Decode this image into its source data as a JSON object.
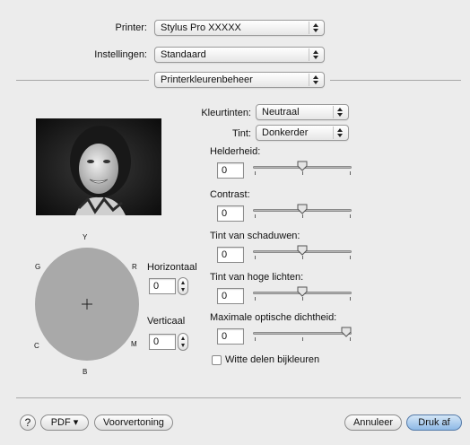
{
  "header": {
    "printer_label": "Printer:",
    "printer_value": "Stylus Pro XXXXX",
    "settings_label": "Instellingen:",
    "settings_value": "Standaard",
    "section_value": "Printerkleurenbeheer"
  },
  "color_tones": {
    "label": "Kleurtinten:",
    "value": "Neutraal"
  },
  "tone": {
    "label": "Tint:",
    "value": "Donkerder"
  },
  "sliders": [
    {
      "label": "Helderheid:",
      "value": "0",
      "level": 0.5
    },
    {
      "label": "Contrast:",
      "value": "0",
      "level": 0.5
    },
    {
      "label": "Tint van schaduwen:",
      "value": "0",
      "level": 0.5
    },
    {
      "label": "Tint van hoge lichten:",
      "value": "0",
      "level": 0.5
    },
    {
      "label": "Maximale optische dichtheid:",
      "value": "0",
      "level": 1.0
    }
  ],
  "color_circle": {
    "labels": {
      "y": "Y",
      "r": "R",
      "m": "M",
      "b": "B",
      "c": "C",
      "g": "G"
    },
    "horizontal_label": "Horizontaal",
    "horizontal_value": "0",
    "vertical_label": "Verticaal",
    "vertical_value": "0",
    "fill_color": "#a9a9a9"
  },
  "checkbox": {
    "label": "Witte delen bijkleuren",
    "checked": false
  },
  "footer": {
    "help_label": "?",
    "pdf_label": "PDF ▾",
    "preview_label": "Voorvertoning",
    "cancel_label": "Annuleer",
    "print_label": "Druk af",
    "accent_color": "#8eb9e6"
  }
}
